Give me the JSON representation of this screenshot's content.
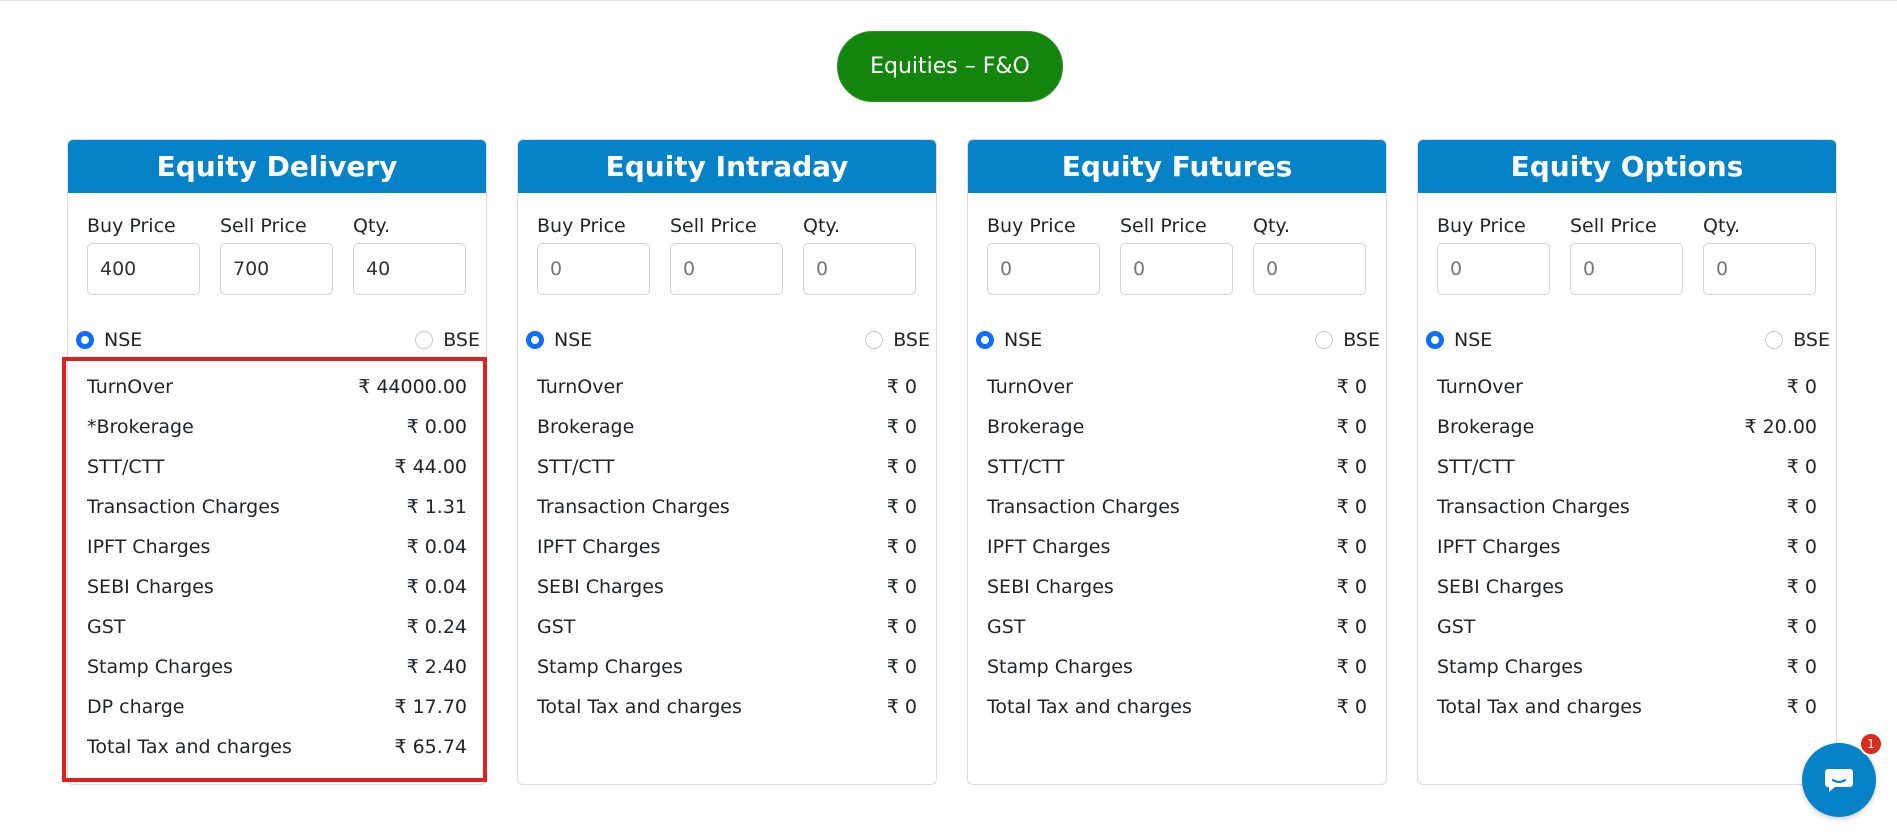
{
  "segment_button": "Equities – F&O",
  "cards": [
    {
      "title": "Equity Delivery",
      "fields": [
        {
          "label": "Buy Price",
          "value": "400"
        },
        {
          "label": "Sell Price",
          "value": "700"
        },
        {
          "label": "Qty.",
          "value": "40"
        }
      ],
      "nse": "NSE",
      "bse": "BSE",
      "rows": [
        {
          "label": "TurnOver",
          "value": "₹ 44000.00"
        },
        {
          "label": "*Brokerage",
          "value": "₹ 0.00"
        },
        {
          "label": "STT/CTT",
          "value": "₹ 44.00"
        },
        {
          "label": "Transaction Charges",
          "value": "₹ 1.31"
        },
        {
          "label": "IPFT Charges",
          "value": "₹ 0.04"
        },
        {
          "label": "SEBI Charges",
          "value": "₹ 0.04"
        },
        {
          "label": "GST",
          "value": "₹ 0.24"
        },
        {
          "label": "Stamp Charges",
          "value": "₹ 2.40"
        },
        {
          "label": "DP charge",
          "value": "₹ 17.70"
        },
        {
          "label": "Total Tax and charges",
          "value": "₹ 65.74"
        }
      ]
    },
    {
      "title": "Equity Intraday",
      "fields": [
        {
          "label": "Buy Price",
          "value": "0"
        },
        {
          "label": "Sell Price",
          "value": "0"
        },
        {
          "label": "Qty.",
          "value": "0"
        }
      ],
      "nse": "NSE",
      "bse": "BSE",
      "rows": [
        {
          "label": "TurnOver",
          "value": "₹ 0"
        },
        {
          "label": "Brokerage",
          "value": "₹ 0"
        },
        {
          "label": "STT/CTT",
          "value": "₹ 0"
        },
        {
          "label": "Transaction Charges",
          "value": "₹ 0"
        },
        {
          "label": "IPFT Charges",
          "value": "₹ 0"
        },
        {
          "label": "SEBI Charges",
          "value": "₹ 0"
        },
        {
          "label": "GST",
          "value": "₹ 0"
        },
        {
          "label": "Stamp Charges",
          "value": "₹ 0"
        },
        {
          "label": "Total Tax and charges",
          "value": "₹ 0"
        }
      ]
    },
    {
      "title": "Equity Futures",
      "fields": [
        {
          "label": "Buy Price",
          "value": "0"
        },
        {
          "label": "Sell Price",
          "value": "0"
        },
        {
          "label": "Qty.",
          "value": "0"
        }
      ],
      "nse": "NSE",
      "bse": "BSE",
      "rows": [
        {
          "label": "TurnOver",
          "value": "₹ 0"
        },
        {
          "label": "Brokerage",
          "value": "₹ 0"
        },
        {
          "label": "STT/CTT",
          "value": "₹ 0"
        },
        {
          "label": "Transaction Charges",
          "value": "₹ 0"
        },
        {
          "label": "IPFT Charges",
          "value": "₹ 0"
        },
        {
          "label": "SEBI Charges",
          "value": "₹ 0"
        },
        {
          "label": "GST",
          "value": "₹ 0"
        },
        {
          "label": "Stamp Charges",
          "value": "₹ 0"
        },
        {
          "label": "Total Tax and charges",
          "value": "₹ 0"
        }
      ]
    },
    {
      "title": "Equity Options",
      "fields": [
        {
          "label": "Buy Price",
          "value": "0"
        },
        {
          "label": "Sell Price",
          "value": "0"
        },
        {
          "label": "Qty.",
          "value": "0"
        }
      ],
      "nse": "NSE",
      "bse": "BSE",
      "rows": [
        {
          "label": "TurnOver",
          "value": "₹ 0"
        },
        {
          "label": "Brokerage",
          "value": "₹ 20.00"
        },
        {
          "label": "STT/CTT",
          "value": "₹ 0"
        },
        {
          "label": "Transaction Charges",
          "value": "₹ 0"
        },
        {
          "label": "IPFT Charges",
          "value": "₹ 0"
        },
        {
          "label": "SEBI Charges",
          "value": "₹ 0"
        },
        {
          "label": "GST",
          "value": "₹ 0"
        },
        {
          "label": "Stamp Charges",
          "value": "₹ 0"
        },
        {
          "label": "Total Tax and charges",
          "value": "₹ 0"
        }
      ]
    }
  ],
  "chat": {
    "badge": "1",
    "icon": "chat-bubble-icon"
  },
  "colors": {
    "segment_green": "#13850c",
    "header_blue": "#0582c8",
    "radio_blue": "#0d6efd",
    "highlight_red": "#e02020"
  }
}
